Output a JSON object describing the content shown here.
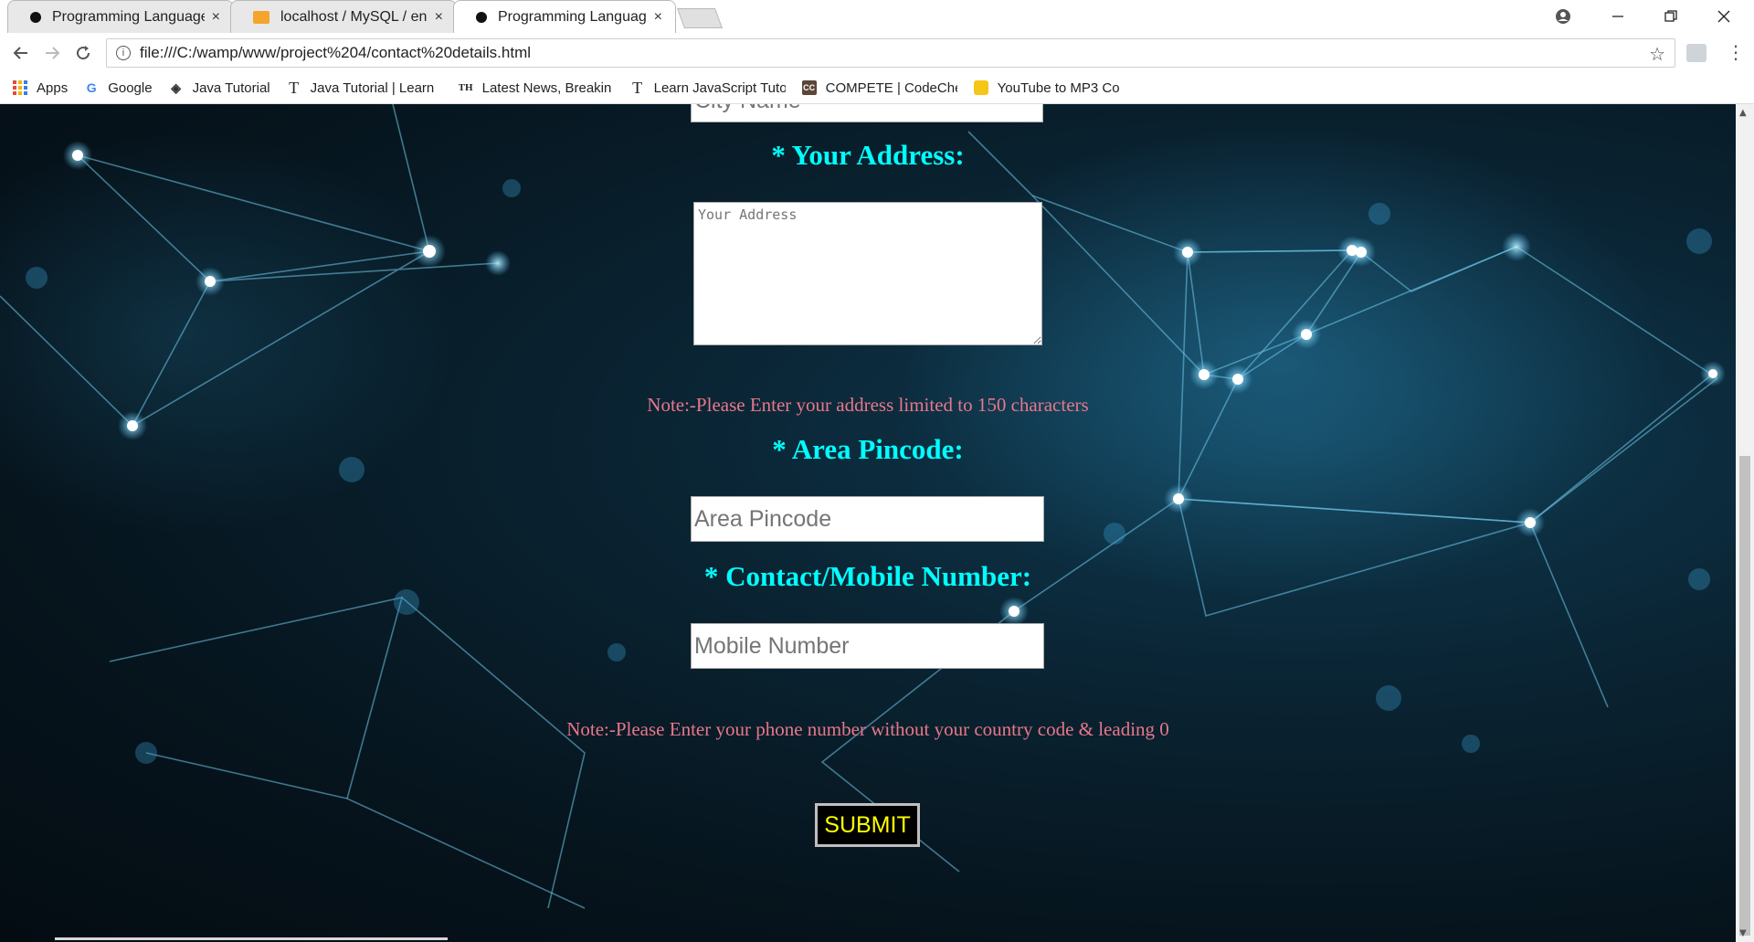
{
  "browser": {
    "tabs": [
      {
        "label": "Programming Languages",
        "icon": "dot-icon",
        "active": false
      },
      {
        "label": "localhost / MySQL / enro",
        "icon": "phpmyadmin-icon",
        "active": false
      },
      {
        "label": "Programming Languages",
        "icon": "dot-icon",
        "active": true
      }
    ],
    "close_glyph": "×",
    "address": "file:///C:/wamp/www/project%204/contact%20details.html",
    "bookmarks": [
      {
        "label": "Apps",
        "icon": "apps-grid-icon"
      },
      {
        "label": "Google",
        "icon": "google-icon"
      },
      {
        "label": "Java Tutorial",
        "icon": "java-diamond-icon"
      },
      {
        "label": "Java Tutorial | Learn",
        "icon": "t-icon"
      },
      {
        "label": "Latest News, Breakin",
        "icon": "th-icon"
      },
      {
        "label": "Learn JavaScript Tuto",
        "icon": "t-icon"
      },
      {
        "label": "COMPETE | CodeChe",
        "icon": "codechef-icon"
      },
      {
        "label": "YouTube to MP3 Co",
        "icon": "ytmp3-icon"
      }
    ]
  },
  "form": {
    "city_placeholder": "City Name",
    "address_label": "* Your Address:",
    "address_placeholder": "Your Address",
    "address_note": "Note:-Please Enter your address limited to 150 characters",
    "pincode_label": "* Area Pincode:",
    "pincode_placeholder": "Area Pincode",
    "mobile_label": "* Contact/Mobile Number:",
    "mobile_placeholder": "Mobile Number",
    "mobile_note": "Note:-Please Enter your phone number without your country code & leading 0",
    "submit_label": "SUBMIT"
  },
  "colors": {
    "heading": "#00ffff",
    "note": "#e8778a",
    "submit_text": "#ffff00"
  }
}
